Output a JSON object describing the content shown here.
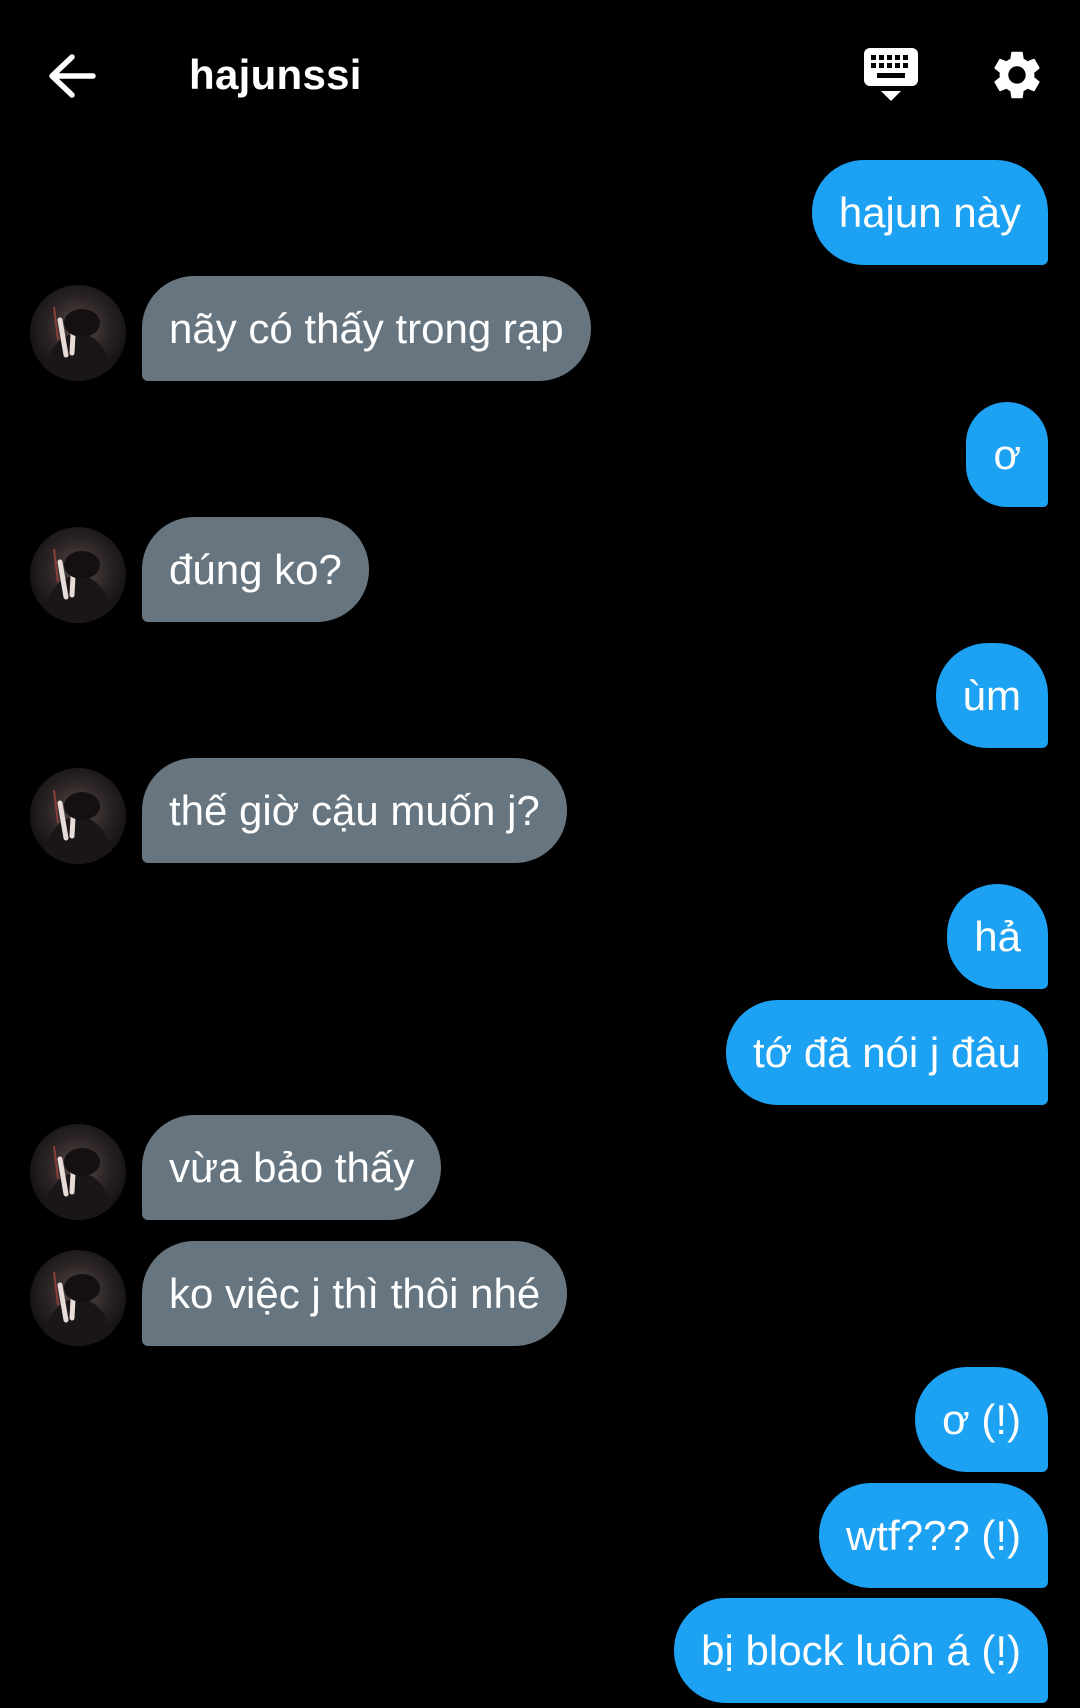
{
  "header": {
    "title": "hajunssi",
    "back_icon": "arrow-left-icon",
    "keyboard_icon": "keyboard-hide-icon",
    "settings_icon": "gear-icon"
  },
  "colors": {
    "background": "#000000",
    "sent_bubble": "#1DA1F2",
    "received_bubble": "#66757F",
    "text": "#FFFFFF"
  },
  "messages": [
    {
      "direction": "sent",
      "text": "hajun này"
    },
    {
      "direction": "received",
      "text": "nãy có thấy trong rạp"
    },
    {
      "direction": "sent",
      "text": "ơ"
    },
    {
      "direction": "received",
      "text": "đúng ko?"
    },
    {
      "direction": "sent",
      "text": "ùm"
    },
    {
      "direction": "received",
      "text": "thế giờ cậu muốn j?"
    },
    {
      "direction": "sent",
      "text": "hả"
    },
    {
      "direction": "sent",
      "text": "tớ đã nói j đâu"
    },
    {
      "direction": "received",
      "text": "vừa bảo thấy"
    },
    {
      "direction": "received",
      "text": "ko việc j thì thôi nhé"
    },
    {
      "direction": "sent",
      "text": "ơ (!)"
    },
    {
      "direction": "sent",
      "text": "wtf??? (!)"
    },
    {
      "direction": "sent",
      "text": "bị block luôn á (!)"
    }
  ]
}
